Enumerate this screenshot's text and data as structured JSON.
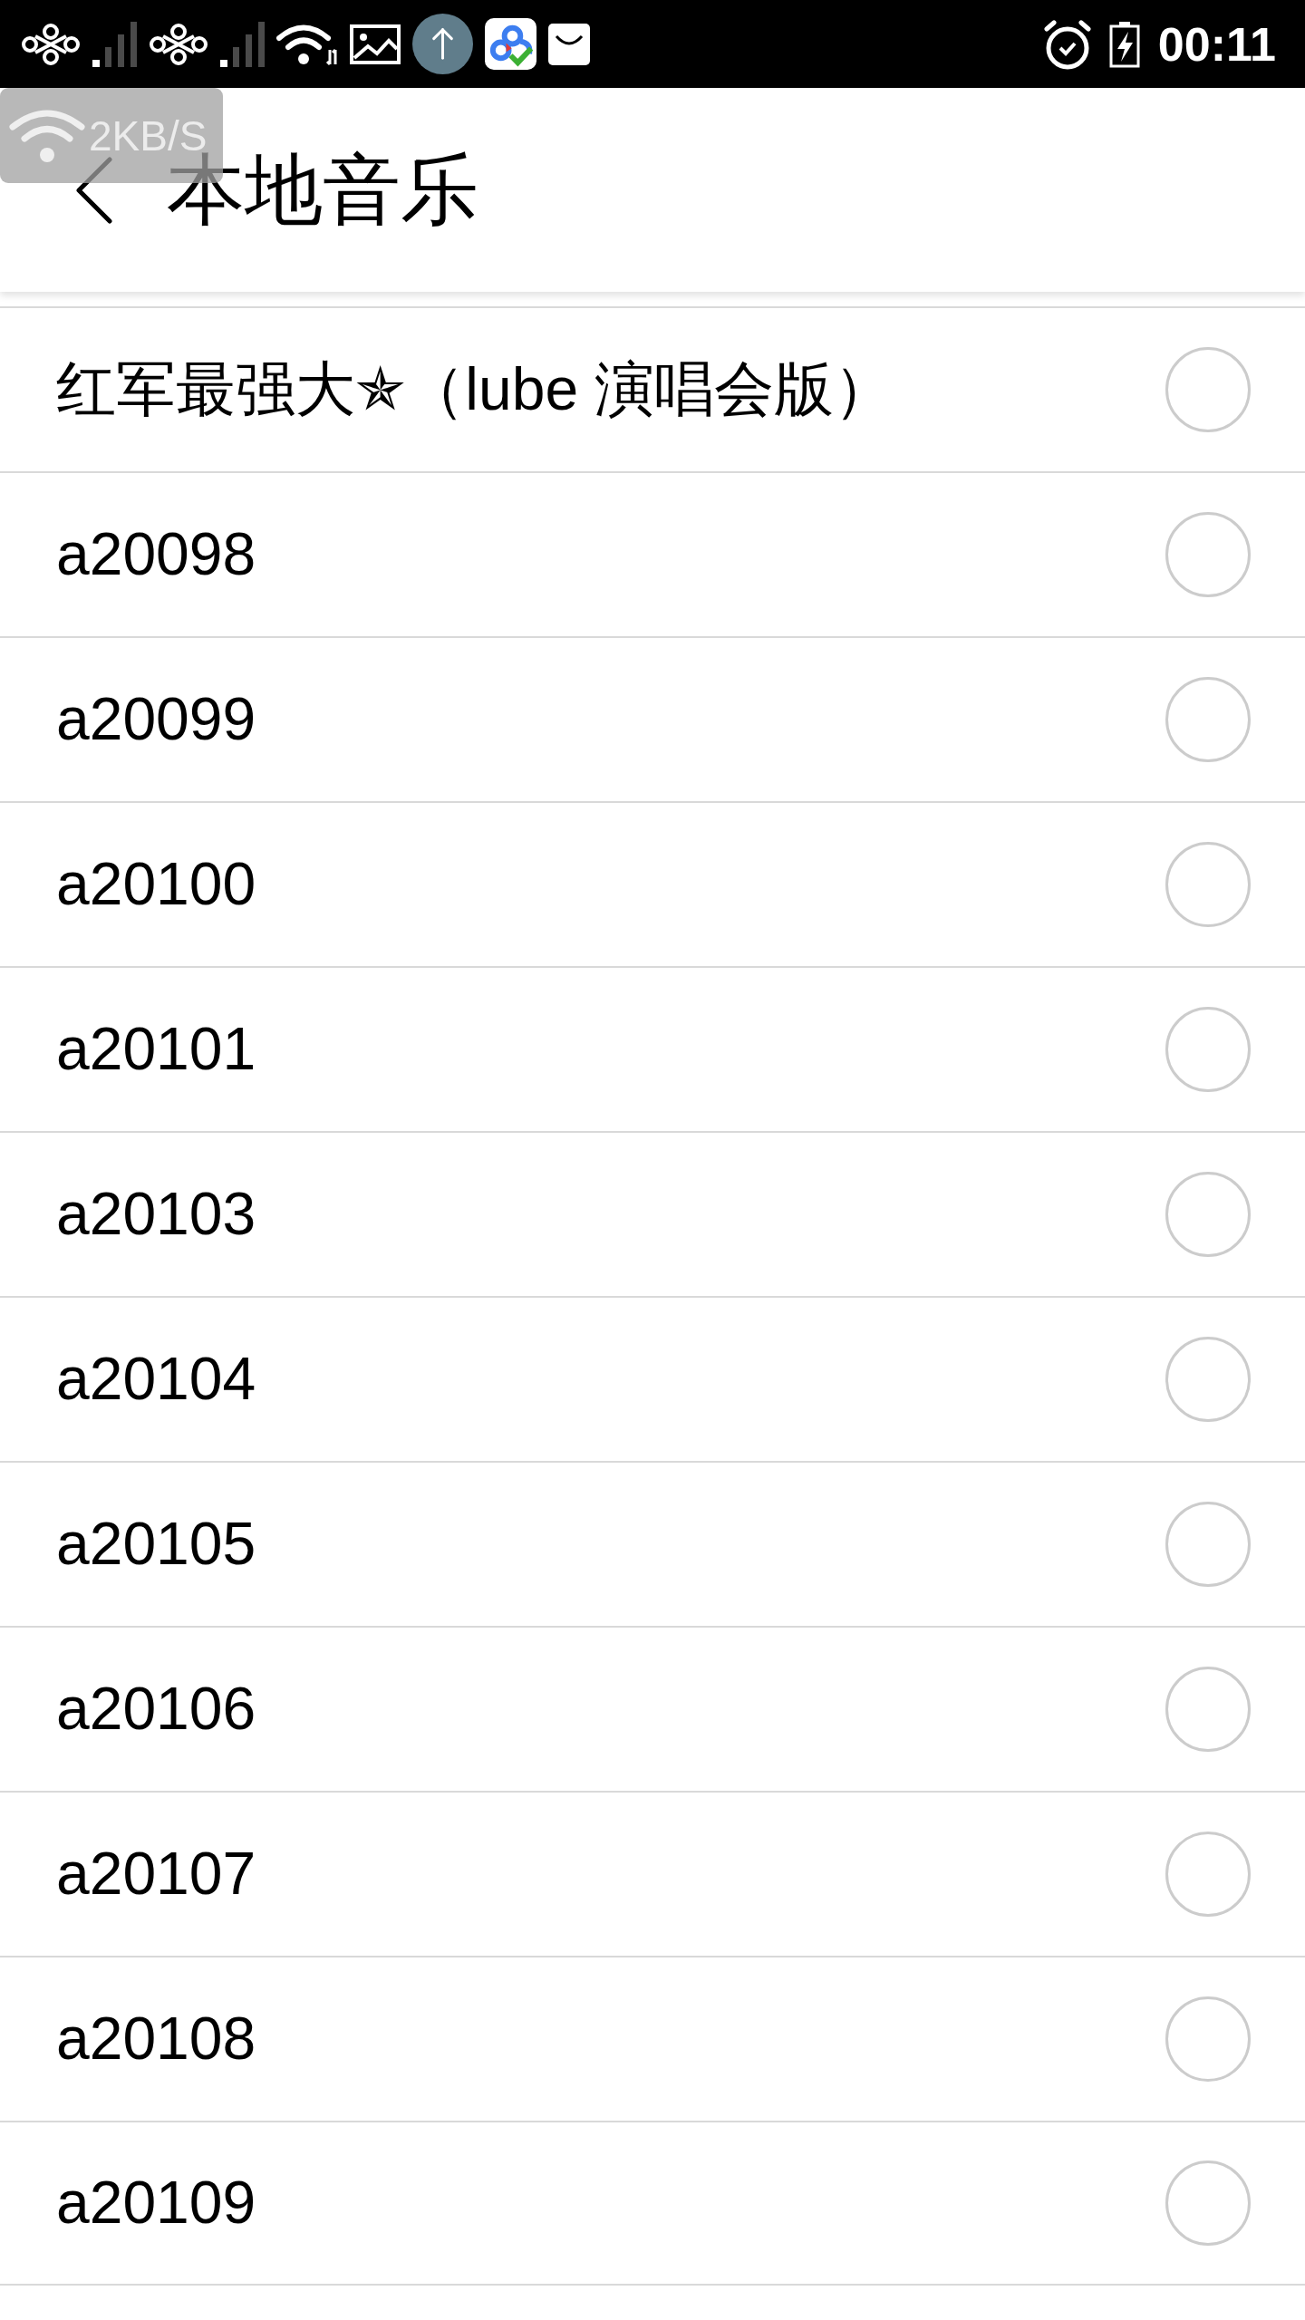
{
  "status_bar": {
    "time": "00:11"
  },
  "speed_overlay": {
    "text": "2KB/S"
  },
  "header": {
    "title": "本地音乐"
  },
  "songs": [
    {
      "title": "红军最强大✯（lube 演唱会版）",
      "selected": false
    },
    {
      "title": "a20098",
      "selected": false
    },
    {
      "title": "a20099",
      "selected": false
    },
    {
      "title": "a20100",
      "selected": false
    },
    {
      "title": "a20101",
      "selected": false
    },
    {
      "title": "a20103",
      "selected": false
    },
    {
      "title": "a20104",
      "selected": false
    },
    {
      "title": "a20105",
      "selected": false
    },
    {
      "title": "a20106",
      "selected": false
    },
    {
      "title": "a20107",
      "selected": false
    },
    {
      "title": "a20108",
      "selected": false
    },
    {
      "title": "a20109",
      "selected": false
    }
  ]
}
